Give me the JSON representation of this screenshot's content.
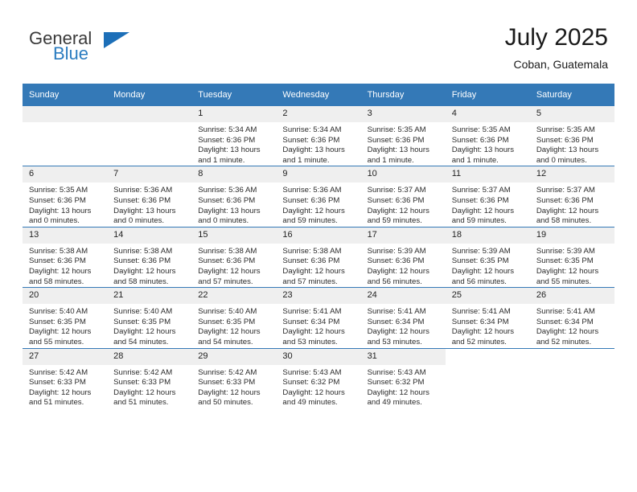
{
  "logo": {
    "primary_text": "General",
    "secondary_text": "Blue",
    "triangle_color": "#1d6fb8",
    "primary_color": "#3a3a3a",
    "secondary_color": "#2b7cc0"
  },
  "header": {
    "title": "July 2025",
    "subtitle": "Coban, Guatemala"
  },
  "theme": {
    "header_blue": "#3479b7",
    "day_strip_gray": "#efefef"
  },
  "weekdays": [
    "Sunday",
    "Monday",
    "Tuesday",
    "Wednesday",
    "Thursday",
    "Friday",
    "Saturday"
  ],
  "weeks": [
    [
      {
        "day": "",
        "sunrise": "",
        "sunset": "",
        "daylight_line1": "",
        "daylight_line2": "",
        "blank": true,
        "strip": true
      },
      {
        "day": "",
        "sunrise": "",
        "sunset": "",
        "daylight_line1": "",
        "daylight_line2": "",
        "blank": true,
        "strip": true
      },
      {
        "day": "1",
        "sunrise": "Sunrise: 5:34 AM",
        "sunset": "Sunset: 6:36 PM",
        "daylight_line1": "Daylight: 13 hours",
        "daylight_line2": "and 1 minute."
      },
      {
        "day": "2",
        "sunrise": "Sunrise: 5:34 AM",
        "sunset": "Sunset: 6:36 PM",
        "daylight_line1": "Daylight: 13 hours",
        "daylight_line2": "and 1 minute."
      },
      {
        "day": "3",
        "sunrise": "Sunrise: 5:35 AM",
        "sunset": "Sunset: 6:36 PM",
        "daylight_line1": "Daylight: 13 hours",
        "daylight_line2": "and 1 minute."
      },
      {
        "day": "4",
        "sunrise": "Sunrise: 5:35 AM",
        "sunset": "Sunset: 6:36 PM",
        "daylight_line1": "Daylight: 13 hours",
        "daylight_line2": "and 1 minute."
      },
      {
        "day": "5",
        "sunrise": "Sunrise: 5:35 AM",
        "sunset": "Sunset: 6:36 PM",
        "daylight_line1": "Daylight: 13 hours",
        "daylight_line2": "and 0 minutes."
      }
    ],
    [
      {
        "day": "6",
        "sunrise": "Sunrise: 5:35 AM",
        "sunset": "Sunset: 6:36 PM",
        "daylight_line1": "Daylight: 13 hours",
        "daylight_line2": "and 0 minutes."
      },
      {
        "day": "7",
        "sunrise": "Sunrise: 5:36 AM",
        "sunset": "Sunset: 6:36 PM",
        "daylight_line1": "Daylight: 13 hours",
        "daylight_line2": "and 0 minutes."
      },
      {
        "day": "8",
        "sunrise": "Sunrise: 5:36 AM",
        "sunset": "Sunset: 6:36 PM",
        "daylight_line1": "Daylight: 13 hours",
        "daylight_line2": "and 0 minutes."
      },
      {
        "day": "9",
        "sunrise": "Sunrise: 5:36 AM",
        "sunset": "Sunset: 6:36 PM",
        "daylight_line1": "Daylight: 12 hours",
        "daylight_line2": "and 59 minutes."
      },
      {
        "day": "10",
        "sunrise": "Sunrise: 5:37 AM",
        "sunset": "Sunset: 6:36 PM",
        "daylight_line1": "Daylight: 12 hours",
        "daylight_line2": "and 59 minutes."
      },
      {
        "day": "11",
        "sunrise": "Sunrise: 5:37 AM",
        "sunset": "Sunset: 6:36 PM",
        "daylight_line1": "Daylight: 12 hours",
        "daylight_line2": "and 59 minutes."
      },
      {
        "day": "12",
        "sunrise": "Sunrise: 5:37 AM",
        "sunset": "Sunset: 6:36 PM",
        "daylight_line1": "Daylight: 12 hours",
        "daylight_line2": "and 58 minutes."
      }
    ],
    [
      {
        "day": "13",
        "sunrise": "Sunrise: 5:38 AM",
        "sunset": "Sunset: 6:36 PM",
        "daylight_line1": "Daylight: 12 hours",
        "daylight_line2": "and 58 minutes."
      },
      {
        "day": "14",
        "sunrise": "Sunrise: 5:38 AM",
        "sunset": "Sunset: 6:36 PM",
        "daylight_line1": "Daylight: 12 hours",
        "daylight_line2": "and 58 minutes."
      },
      {
        "day": "15",
        "sunrise": "Sunrise: 5:38 AM",
        "sunset": "Sunset: 6:36 PM",
        "daylight_line1": "Daylight: 12 hours",
        "daylight_line2": "and 57 minutes."
      },
      {
        "day": "16",
        "sunrise": "Sunrise: 5:38 AM",
        "sunset": "Sunset: 6:36 PM",
        "daylight_line1": "Daylight: 12 hours",
        "daylight_line2": "and 57 minutes."
      },
      {
        "day": "17",
        "sunrise": "Sunrise: 5:39 AM",
        "sunset": "Sunset: 6:36 PM",
        "daylight_line1": "Daylight: 12 hours",
        "daylight_line2": "and 56 minutes."
      },
      {
        "day": "18",
        "sunrise": "Sunrise: 5:39 AM",
        "sunset": "Sunset: 6:35 PM",
        "daylight_line1": "Daylight: 12 hours",
        "daylight_line2": "and 56 minutes."
      },
      {
        "day": "19",
        "sunrise": "Sunrise: 5:39 AM",
        "sunset": "Sunset: 6:35 PM",
        "daylight_line1": "Daylight: 12 hours",
        "daylight_line2": "and 55 minutes."
      }
    ],
    [
      {
        "day": "20",
        "sunrise": "Sunrise: 5:40 AM",
        "sunset": "Sunset: 6:35 PM",
        "daylight_line1": "Daylight: 12 hours",
        "daylight_line2": "and 55 minutes."
      },
      {
        "day": "21",
        "sunrise": "Sunrise: 5:40 AM",
        "sunset": "Sunset: 6:35 PM",
        "daylight_line1": "Daylight: 12 hours",
        "daylight_line2": "and 54 minutes."
      },
      {
        "day": "22",
        "sunrise": "Sunrise: 5:40 AM",
        "sunset": "Sunset: 6:35 PM",
        "daylight_line1": "Daylight: 12 hours",
        "daylight_line2": "and 54 minutes."
      },
      {
        "day": "23",
        "sunrise": "Sunrise: 5:41 AM",
        "sunset": "Sunset: 6:34 PM",
        "daylight_line1": "Daylight: 12 hours",
        "daylight_line2": "and 53 minutes."
      },
      {
        "day": "24",
        "sunrise": "Sunrise: 5:41 AM",
        "sunset": "Sunset: 6:34 PM",
        "daylight_line1": "Daylight: 12 hours",
        "daylight_line2": "and 53 minutes."
      },
      {
        "day": "25",
        "sunrise": "Sunrise: 5:41 AM",
        "sunset": "Sunset: 6:34 PM",
        "daylight_line1": "Daylight: 12 hours",
        "daylight_line2": "and 52 minutes."
      },
      {
        "day": "26",
        "sunrise": "Sunrise: 5:41 AM",
        "sunset": "Sunset: 6:34 PM",
        "daylight_line1": "Daylight: 12 hours",
        "daylight_line2": "and 52 minutes."
      }
    ],
    [
      {
        "day": "27",
        "sunrise": "Sunrise: 5:42 AM",
        "sunset": "Sunset: 6:33 PM",
        "daylight_line1": "Daylight: 12 hours",
        "daylight_line2": "and 51 minutes."
      },
      {
        "day": "28",
        "sunrise": "Sunrise: 5:42 AM",
        "sunset": "Sunset: 6:33 PM",
        "daylight_line1": "Daylight: 12 hours",
        "daylight_line2": "and 51 minutes."
      },
      {
        "day": "29",
        "sunrise": "Sunrise: 5:42 AM",
        "sunset": "Sunset: 6:33 PM",
        "daylight_line1": "Daylight: 12 hours",
        "daylight_line2": "and 50 minutes."
      },
      {
        "day": "30",
        "sunrise": "Sunrise: 5:43 AM",
        "sunset": "Sunset: 6:32 PM",
        "daylight_line1": "Daylight: 12 hours",
        "daylight_line2": "and 49 minutes."
      },
      {
        "day": "31",
        "sunrise": "Sunrise: 5:43 AM",
        "sunset": "Sunset: 6:32 PM",
        "daylight_line1": "Daylight: 12 hours",
        "daylight_line2": "and 49 minutes."
      },
      {
        "day": "",
        "sunrise": "",
        "sunset": "",
        "daylight_line1": "",
        "daylight_line2": "",
        "blank": true,
        "strip": false
      },
      {
        "day": "",
        "sunrise": "",
        "sunset": "",
        "daylight_line1": "",
        "daylight_line2": "",
        "blank": true,
        "strip": false
      }
    ]
  ]
}
